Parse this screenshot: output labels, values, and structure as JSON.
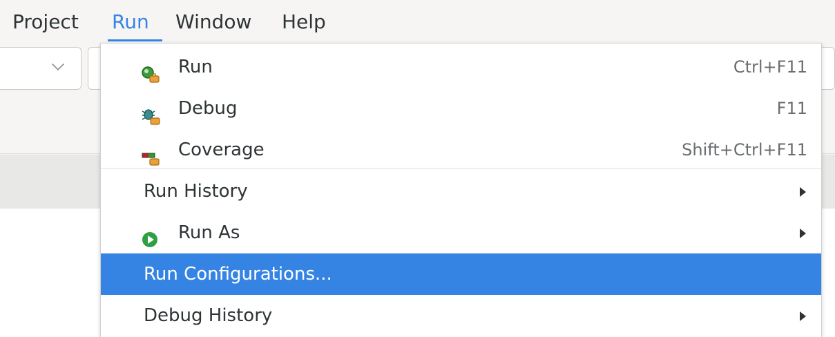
{
  "menubar": {
    "items": [
      {
        "label": "Project"
      },
      {
        "label": "Run"
      },
      {
        "label": "Window"
      },
      {
        "label": "Help"
      }
    ],
    "active": "Run"
  },
  "run_menu": {
    "items": [
      {
        "label": "Run",
        "accelerator": "Ctrl+F11",
        "icon": "run-icon"
      },
      {
        "label": "Debug",
        "accelerator": "F11",
        "icon": "debug-icon"
      },
      {
        "label": "Coverage",
        "accelerator": "Shift+Ctrl+F11",
        "icon": "coverage-icon"
      },
      {
        "label": "Run History",
        "submenu": true
      },
      {
        "label": "Run As",
        "submenu": true,
        "icon": "run-as-icon"
      },
      {
        "label": "Run Configurations...",
        "selected": true
      },
      {
        "label": "Debug History",
        "submenu": true
      }
    ]
  },
  "colors": {
    "accent": "#3584e4",
    "run_green": "#2ea043"
  }
}
